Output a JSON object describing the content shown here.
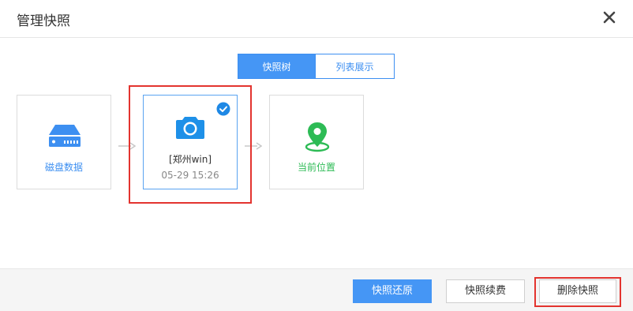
{
  "dialog": {
    "title": "管理快照"
  },
  "tabs": [
    {
      "label": "快照树",
      "active": true
    },
    {
      "label": "列表展示",
      "active": false
    }
  ],
  "nodes": {
    "disk": {
      "label": "磁盘数据",
      "icon": "hard-drive-icon"
    },
    "snapshot": {
      "name": "[郑州win]",
      "time": "05-29 15:26",
      "icon": "camera-icon",
      "selected": true
    },
    "current": {
      "label": "当前位置",
      "icon": "location-pin-icon"
    }
  },
  "buttons": {
    "restore": "快照还原",
    "renew": "快照续费",
    "delete": "删除快照"
  },
  "colors": {
    "primary": "#4596f5",
    "green": "#2dbb55",
    "highlight_red": "#e3342f"
  }
}
